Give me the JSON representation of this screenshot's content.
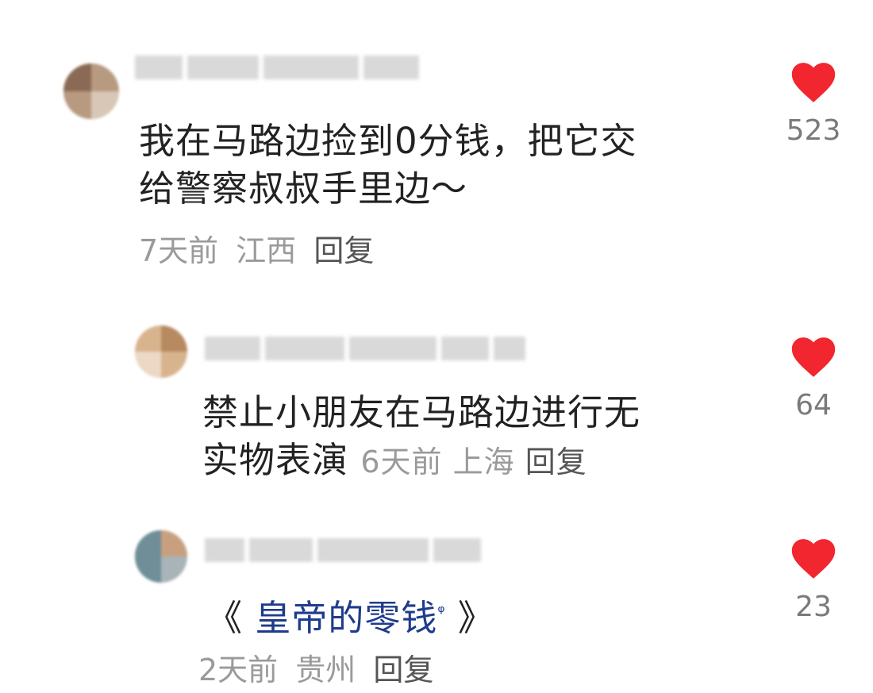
{
  "comments": [
    {
      "text_line1": "我在马路边捡到0分钱，把它交",
      "text_line2": "给警察叔叔手里边～",
      "time": "7天前",
      "location": "江西",
      "reply_label": "回复",
      "likes": "523"
    },
    {
      "text_line1": "禁止小朋友在马路边进行无",
      "text_line2": "实物表演",
      "time": "6天前",
      "location": "上海",
      "reply_label": "回复",
      "likes": "64"
    },
    {
      "bracket_open": "《",
      "link_text": "皇帝的零钱",
      "link_icon": "ᵠ",
      "bracket_close": "》",
      "time": "2天前",
      "location": "贵州",
      "reply_label": "回复",
      "likes": "23"
    }
  ],
  "icons": {
    "like": "heart-icon"
  },
  "colors": {
    "like": "#f2262e",
    "link": "#1f3b8c"
  }
}
